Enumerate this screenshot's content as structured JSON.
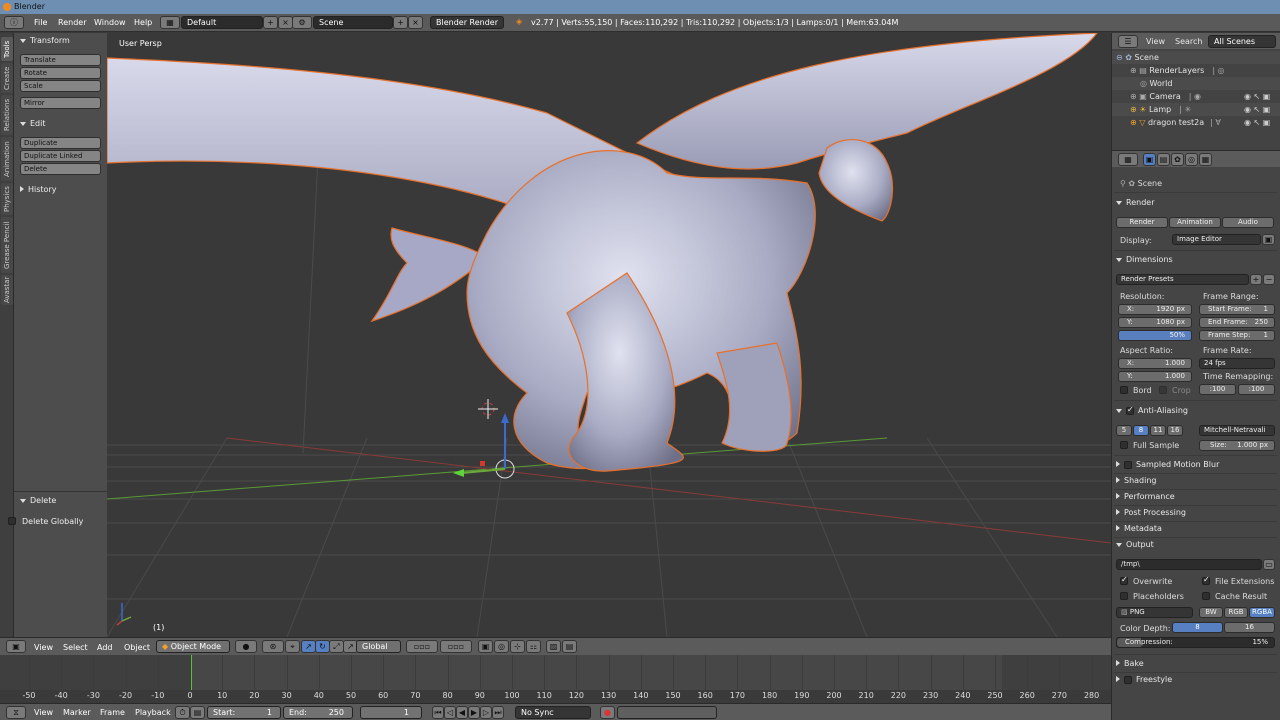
{
  "title": "Blender",
  "topbar": {
    "menus": [
      "File",
      "Render",
      "Window",
      "Help"
    ],
    "layout": "Default",
    "scene": "Scene",
    "engine": "Blender Render",
    "stats": "v2.77 | Verts:55,150 | Faces:110,292 | Tris:110,292 | Objects:1/3 | Lamps:0/1 | Mem:63.04M"
  },
  "side_tabs": [
    "Tools",
    "Create",
    "Relations",
    "Animation",
    "Physics",
    "Grease Pencil",
    "Avastar"
  ],
  "tools": {
    "transform_header": "Transform",
    "transform_buttons": [
      "Translate",
      "Rotate",
      "Scale"
    ],
    "mirror": "Mirror",
    "edit_header": "Edit",
    "edit_buttons": [
      "Duplicate",
      "Duplicate Linked",
      "Delete"
    ],
    "history_header": "History",
    "op_header": "Delete",
    "op_option": "Delete Globally"
  },
  "viewport": {
    "view_label": "User Persp",
    "frame_label": "(1)"
  },
  "view_header": {
    "menus": [
      "View",
      "Select",
      "Add",
      "Object"
    ],
    "mode": "Object Mode",
    "orientation": "Global"
  },
  "timeline": {
    "ticks": [
      "-50",
      "-40",
      "-30",
      "-20",
      "-10",
      "0",
      "10",
      "20",
      "30",
      "40",
      "50",
      "60",
      "70",
      "80",
      "90",
      "100",
      "110",
      "120",
      "130",
      "140",
      "150",
      "160",
      "170",
      "180",
      "190",
      "200",
      "210",
      "220",
      "230",
      "240",
      "250",
      "260",
      "270",
      "280"
    ],
    "menus": [
      "View",
      "Marker",
      "Frame",
      "Playback"
    ],
    "start_label": "Start:",
    "start_value": "1",
    "end_label": "End:",
    "end_value": "250",
    "current": "1",
    "sync": "No Sync"
  },
  "outliner": {
    "menus": [
      "View",
      "Search"
    ],
    "scenes": "All Scenes",
    "rows": [
      "Scene",
      "RenderLayers",
      "World",
      "Camera",
      "Lamp",
      "dragon test2a"
    ]
  },
  "properties": {
    "context": "Scene",
    "render_header": "Render",
    "render_buttons": [
      "Render",
      "Animation",
      "Audio"
    ],
    "display_label": "Display:",
    "display_value": "Image Editor",
    "dimensions_header": "Dimensions",
    "presets": "Render Presets",
    "resolution_label": "Resolution:",
    "res_x_label": "X:",
    "res_x": "1920 px",
    "res_y_label": "Y:",
    "res_y": "1080 px",
    "res_pct": "50%",
    "frame_range_label": "Frame Range:",
    "start_frame_label": "Start Frame:",
    "start_frame": "1",
    "end_frame_label": "End Frame:",
    "end_frame": "250",
    "frame_step_label": "Frame Step:",
    "frame_step": "1",
    "aspect_label": "Aspect Ratio:",
    "aspect_x_label": "X:",
    "aspect_x": "1.000",
    "aspect_y_label": "Y:",
    "aspect_y": "1.000",
    "frame_rate_label": "Frame Rate:",
    "fps": "24 fps",
    "time_remap_label": "Time Remapping:",
    "remap_old": ":100",
    "remap_new": ":100",
    "bord": "Bord",
    "crop": "Crop",
    "aa_header": "Anti-Aliasing",
    "aa_samples": [
      "5",
      "8",
      "11",
      "16"
    ],
    "aa_filter": "Mitchell-Netravali",
    "full_sample": "Full Sample",
    "size_label": "Size:",
    "size_value": "1.000 px",
    "collapsed": [
      "Sampled Motion Blur",
      "Shading",
      "Performance",
      "Post Processing",
      "Metadata"
    ],
    "output_header": "Output",
    "output_path": "/tmp\\",
    "overwrite": "Overwrite",
    "file_extensions": "File Extensions",
    "placeholders": "Placeholders",
    "cache_result": "Cache Result",
    "format": "PNG",
    "color_modes": [
      "BW",
      "RGB",
      "RGBA"
    ],
    "color_depth_label": "Color Depth:",
    "depths": [
      "8",
      "16"
    ],
    "compression_label": "Compression:",
    "compression": "15%",
    "bake": "Bake",
    "freestyle": "Freestyle"
  },
  "colors": {
    "selection": "#5680c2",
    "object_outline": "#e8702a",
    "x_axis": "#b8433f",
    "y_axis": "#6ba93a",
    "z_axis": "#3b6bd0"
  }
}
